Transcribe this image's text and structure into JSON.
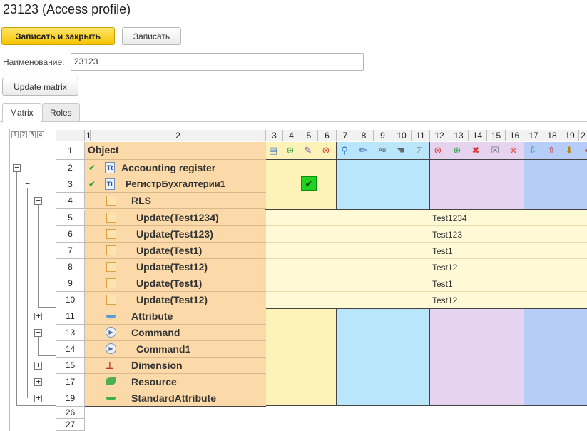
{
  "window": {
    "title": "23123 (Access profile)"
  },
  "toolbar": {
    "save_close_label": "Записать и закрыть",
    "save_label": "Записать"
  },
  "form": {
    "name_label": "Наименование:",
    "name_value": "23123",
    "update_label": "Update matrix"
  },
  "tabs": [
    {
      "label": "Matrix"
    },
    {
      "label": "Roles"
    }
  ],
  "grid": {
    "levels": [
      "1",
      "2",
      "3",
      "4"
    ],
    "columns": [
      "1",
      "2",
      "3",
      "4",
      "5",
      "6",
      "7",
      "8",
      "9",
      "10",
      "11",
      "12",
      "13",
      "14",
      "15",
      "16",
      "17",
      "18",
      "19",
      "2"
    ],
    "header_object": "Object",
    "rows": [
      {
        "num": "1",
        "label": "Object"
      },
      {
        "num": "2",
        "label": "Accounting register"
      },
      {
        "num": "3",
        "label": "РегистрБухгалтерии1"
      },
      {
        "num": "4",
        "label": "RLS"
      },
      {
        "num": "5",
        "label": "Update(Test1234)",
        "value": "Test1234"
      },
      {
        "num": "6",
        "label": "Update(Test123)",
        "value": "Test123"
      },
      {
        "num": "7",
        "label": "Update(Test1)",
        "value": "Test1"
      },
      {
        "num": "8",
        "label": "Update(Test12)",
        "value": "Test12"
      },
      {
        "num": "9",
        "label": "Update(Test1)",
        "value": "Test1"
      },
      {
        "num": "10",
        "label": "Update(Test12)",
        "value": "Test12"
      },
      {
        "num": "11",
        "label": "Attribute"
      },
      {
        "num": "13",
        "label": "Command"
      },
      {
        "num": "14",
        "label": "Command1"
      },
      {
        "num": "15",
        "label": "Dimension"
      },
      {
        "num": "17",
        "label": "Resource"
      },
      {
        "num": "19",
        "label": "StandardAttribute"
      },
      {
        "num": "26",
        "label": ""
      },
      {
        "num": "27",
        "label": ""
      }
    ]
  },
  "colors": {
    "yellow_band": "#fdf3b8",
    "blue_band": "#b9e6fb",
    "purple_band": "#e6d3f0",
    "blue2_band": "#b6cdf7",
    "object_column": "#fcd9a8",
    "check_green": "#21d321"
  }
}
